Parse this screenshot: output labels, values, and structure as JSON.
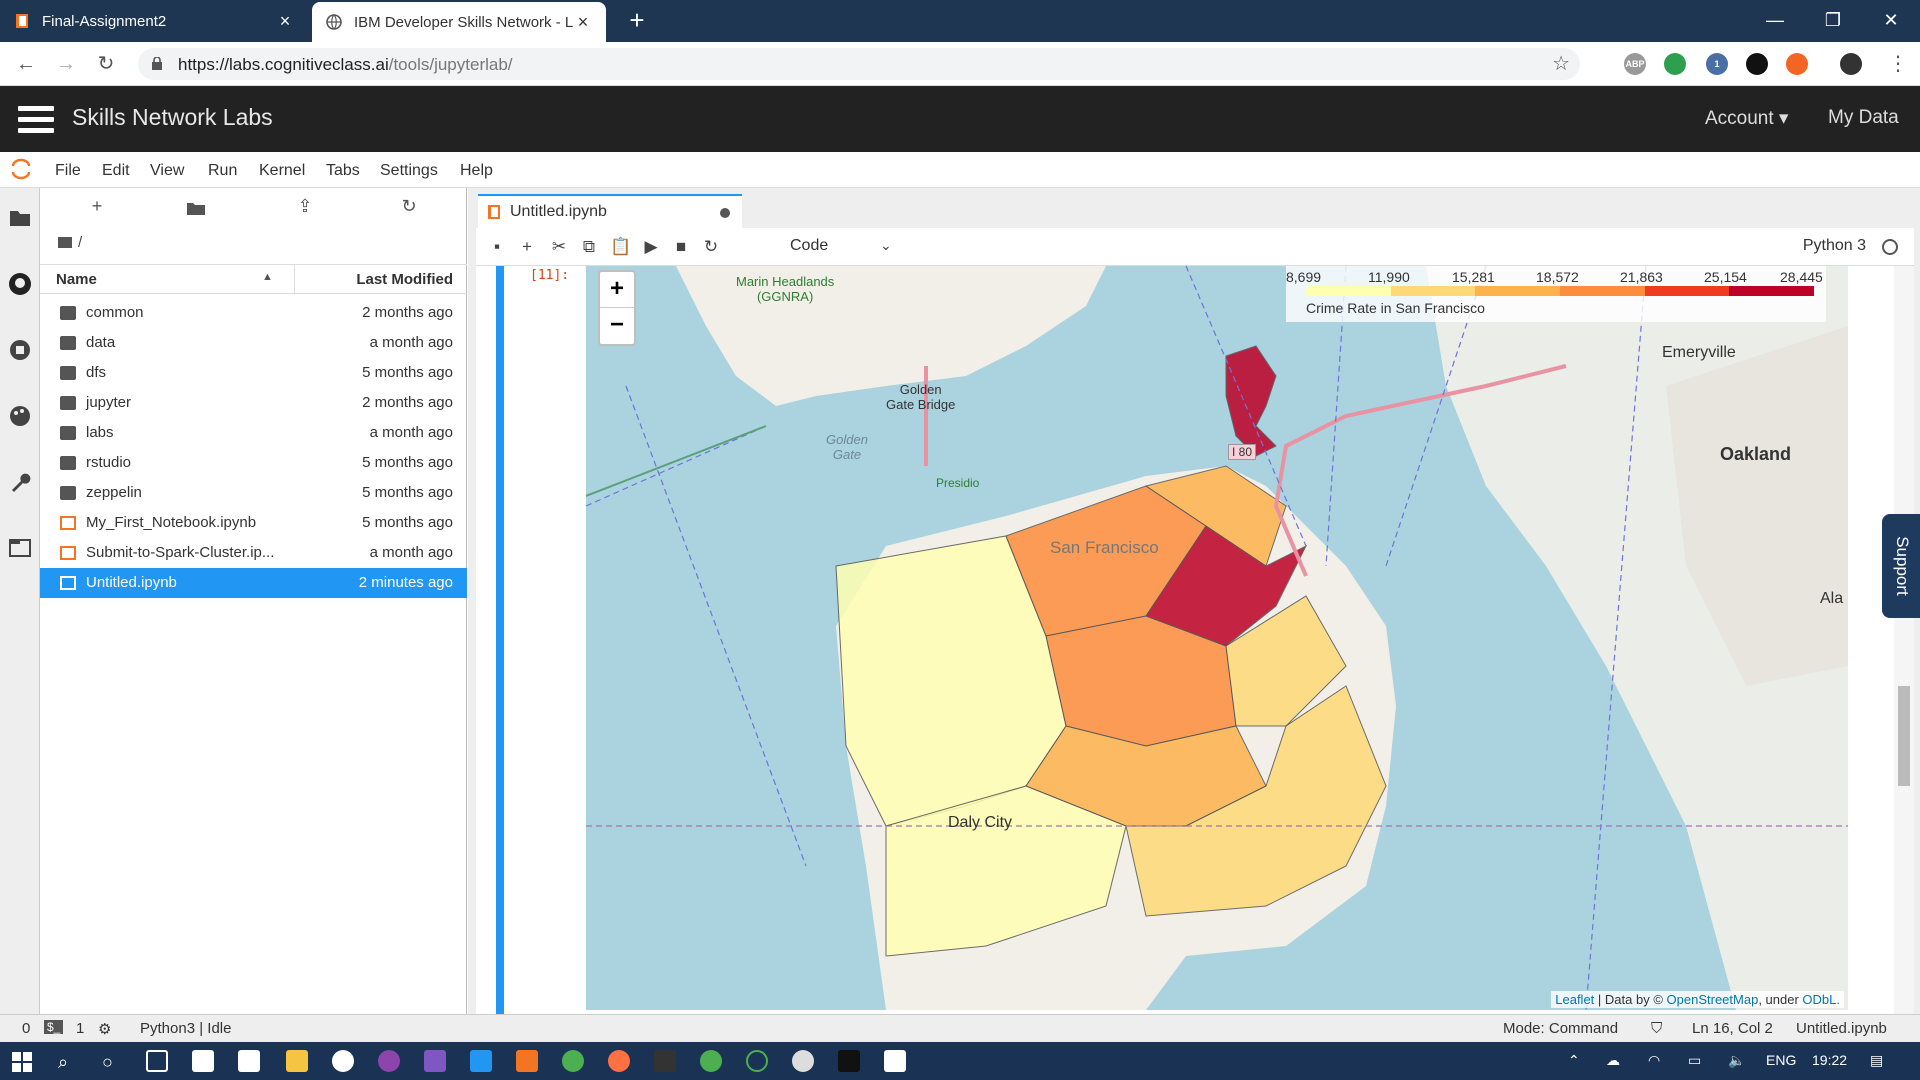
{
  "browser": {
    "tabs": [
      {
        "label": "Final-Assignment2",
        "active": false
      },
      {
        "label": "IBM Developer Skills Network - L",
        "active": true
      }
    ],
    "new_tab": "+",
    "url_host": "https://labs.cognitiveclass.ai",
    "url_path": "/tools/jupyterlab/",
    "extensions": [
      "ABP",
      "1"
    ]
  },
  "app": {
    "brand": "Skills Network Labs",
    "account": "Account",
    "my_data": "My Data"
  },
  "menu": [
    "File",
    "Edit",
    "View",
    "Run",
    "Kernel",
    "Tabs",
    "Settings",
    "Help"
  ],
  "filebrowser": {
    "breadcrumb": "/",
    "col_name": "Name",
    "col_modified": "Last Modified",
    "rows": [
      {
        "name": "common",
        "modified": "2 months ago",
        "type": "folder"
      },
      {
        "name": "data",
        "modified": "a month ago",
        "type": "folder"
      },
      {
        "name": "dfs",
        "modified": "5 months ago",
        "type": "folder"
      },
      {
        "name": "jupyter",
        "modified": "2 months ago",
        "type": "folder"
      },
      {
        "name": "labs",
        "modified": "a month ago",
        "type": "folder"
      },
      {
        "name": "rstudio",
        "modified": "5 months ago",
        "type": "folder"
      },
      {
        "name": "zeppelin",
        "modified": "5 months ago",
        "type": "folder"
      },
      {
        "name": "My_First_Notebook.ipynb",
        "modified": "5 months ago",
        "type": "notebook"
      },
      {
        "name": "Submit-to-Spark-Cluster.ip...",
        "modified": "a month ago",
        "type": "notebook"
      },
      {
        "name": "Untitled.ipynb",
        "modified": "2 minutes ago",
        "type": "notebook",
        "selected": true
      }
    ]
  },
  "notebook": {
    "tab_label": "Untitled.ipynb",
    "cell_type": "Code",
    "kernel": "Python 3",
    "prompt": "[11]:"
  },
  "map": {
    "zoom_in": "+",
    "zoom_out": "−",
    "legend": {
      "ticks": [
        "8,699",
        "11,990",
        "15,281",
        "18,572",
        "21,863",
        "25,154",
        "28,445"
      ],
      "caption": "Crime Rate in San Francisco",
      "colors": [
        "#ffffb2",
        "#fed976",
        "#feb24c",
        "#fd8d3c",
        "#f03b20",
        "#bd0026"
      ]
    },
    "labels": {
      "marin": "Marin Headlands",
      "ggnra": "(GGNRA)",
      "golden_gate_bridge_1": "Golden",
      "golden_gate_bridge_2": "Gate Bridge",
      "golden_gate_1": "Golden",
      "golden_gate_2": "Gate",
      "presidio": "Presidio",
      "san_francisco": "San Francisco",
      "emeryville": "Emeryville",
      "oakland": "Oakland",
      "alameda": "Ala",
      "daly_city": "Daly City",
      "i80": "I 80"
    },
    "attribution": {
      "leaflet": "Leaflet",
      "data_by": "| Data by ©",
      "osm": "OpenStreetMap",
      "under": ", under",
      "odbl": "ODbL."
    }
  },
  "support": "Support",
  "status": {
    "zero": "0",
    "one": "1",
    "kernel_status": "Python3 | Idle",
    "mode": "Mode: Command",
    "position": "Ln 16, Col 2",
    "file": "Untitled.ipynb"
  },
  "taskbar": {
    "lang": "ENG",
    "time": "19:22"
  }
}
